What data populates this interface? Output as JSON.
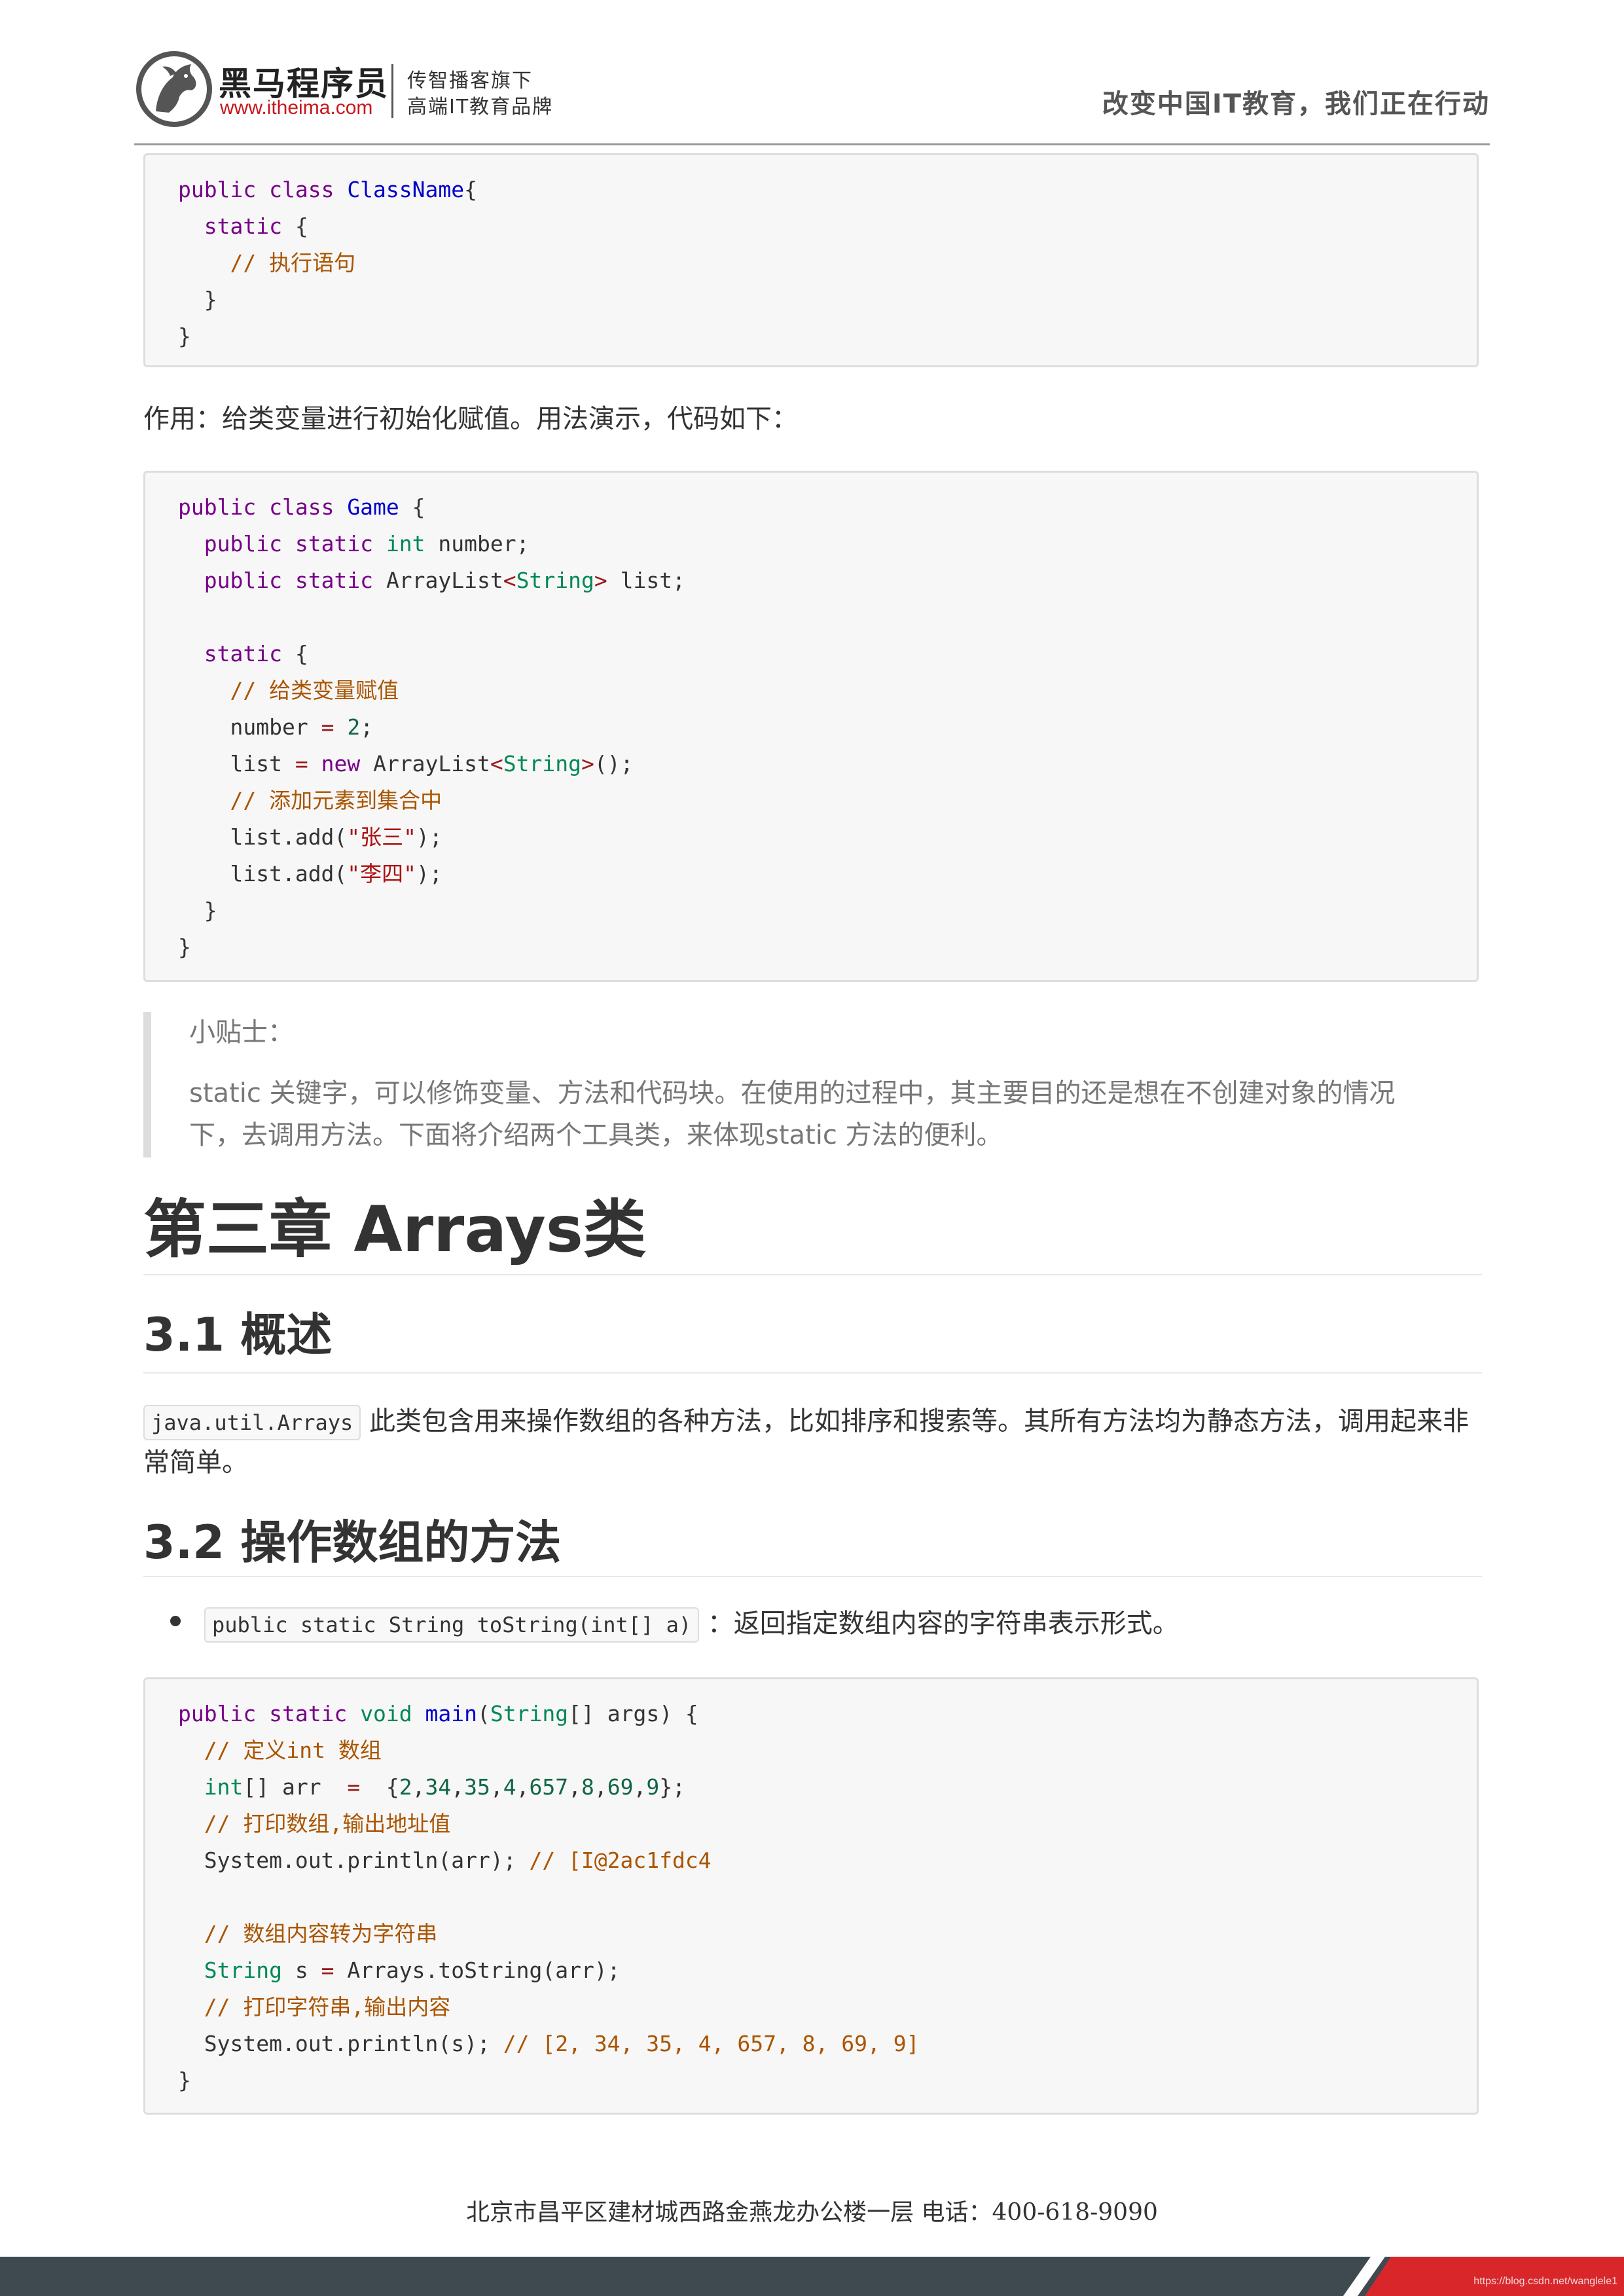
{
  "header": {
    "brand": "黑马程序员",
    "url": "www.itheima.com",
    "tagline_1": "传智播客旗下",
    "tagline_2": "高端IT教育品牌",
    "slogan": "改变中国IT教育，我们正在行动",
    "logo_icon": "horse-head-logo-icon"
  },
  "code1": {
    "l1_a": "public",
    "l1_b": "class",
    "l1_c": "ClassName",
    "l1_d": "{",
    "l2_a": "static",
    "l2_b": "{",
    "l3_comment": "// 执行语句",
    "l4": "}",
    "l5": "}"
  },
  "para1": "作用：给类变量进行初始化赋值。用法演示，代码如下：",
  "code2": {
    "l1_a": "public",
    "l1_b": "class",
    "l1_c": "Game",
    "l1_d": "{",
    "l2_a": "public",
    "l2_b": "static",
    "l2_c": "int",
    "l2_d": "number;",
    "l3_a": "public",
    "l3_b": "static",
    "l3_c": "ArrayList",
    "l3_d": "<",
    "l3_e": "String",
    "l3_f": ">",
    "l3_g": "list;",
    "l5_a": "static",
    "l5_b": "{",
    "l6_comment": "// 给类变量赋值",
    "l7_a": "number",
    "l7_b": "=",
    "l7_c": "2",
    "l7_d": ";",
    "l8_a": "list",
    "l8_b": "=",
    "l8_c": "new",
    "l8_d": "ArrayList",
    "l8_e": "<",
    "l8_f": "String",
    "l8_g": ">",
    "l8_h": "();",
    "l9_comment": "// 添加元素到集合中",
    "l10_a": "list.add(",
    "l10_b": "\"张三\"",
    "l10_c": ");",
    "l11_a": "list.add(",
    "l11_b": "\"李四\"",
    "l11_c": ");",
    "l12": "}",
    "l13": "}"
  },
  "tips": {
    "title": "小贴士：",
    "body": "static 关键字，可以修饰变量、方法和代码块。在使用的过程中，其主要目的还是想在不创建对象的情况下，去调用方法。下面将介绍两个工具类，来体现static 方法的便利。"
  },
  "chapter_title": "第三章 Arrays类",
  "section_1": {
    "title": "3.1 概述",
    "code": "java.util.Arrays",
    "text": "此类包含用来操作数组的各种方法，比如排序和搜索等。其所有方法均为静态方法，调用起来非常简单。"
  },
  "section_2": {
    "title": "3.2 操作数组的方法",
    "bullet_code": "public static String toString(int[] a)",
    "bullet_text": "：返回指定数组内容的字符串表示形式。"
  },
  "code3": {
    "l1_a": "public",
    "l1_b": "static",
    "l1_c": "void",
    "l1_d": "main",
    "l1_e": "(",
    "l1_f": "String",
    "l1_g": "[] args) {",
    "l2_comment": "// 定义int 数组",
    "l3_a": "int",
    "l3_b": "[] arr  ",
    "l3_c": "=",
    "l3_d": "  {",
    "l3_e": "2",
    "l3_f": ",",
    "l3_g": "34",
    "l3_h": ",",
    "l3_i": "35",
    "l3_j": ",",
    "l3_k": "4",
    "l3_l": ",",
    "l3_m": "657",
    "l3_n": ",",
    "l3_o": "8",
    "l3_p": ",",
    "l3_q": "69",
    "l3_r": ",",
    "l3_s": "9",
    "l3_t": "};",
    "l4_comment": "// 打印数组,输出地址值",
    "l5_a": "System.out.println(arr); ",
    "l5_comment": "// [I@2ac1fdc4",
    "l7_comment": "// 数组内容转为字符串",
    "l8_a": "String",
    "l8_b": " s ",
    "l8_c": "=",
    "l8_d": " Arrays.toString(arr);",
    "l9_comment": "// 打印字符串,输出内容",
    "l10_a": "System.out.println(s); ",
    "l10_comment": "// [2, 34, 35, 4, 657, 8, 69, 9]",
    "l11": "}"
  },
  "footer": {
    "address": "北京市昌平区建材城西路金燕龙办公楼一层      电话：400-618-9090",
    "watermark": "https://blog.csdn.net/wanglele1"
  },
  "colors": {
    "keyword": "#770088",
    "definition": "#0000cc",
    "type": "#008855",
    "number": "#116644",
    "string": "#aa1111",
    "comment": "#aa5500",
    "brand_red": "#d9262a",
    "footer_bar": "#3e4a4f"
  }
}
